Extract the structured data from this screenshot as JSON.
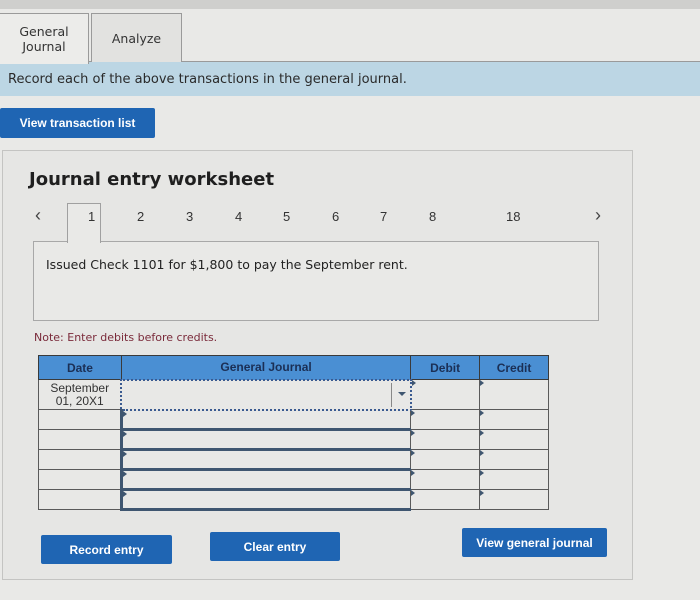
{
  "tabs": [
    {
      "label": "General Journal",
      "active": true
    },
    {
      "label": "Analyze",
      "active": false
    }
  ],
  "instruction": "Record each of the above transactions in the general journal.",
  "view_transaction_list_label": "View transaction list",
  "worksheet": {
    "title": "Journal entry worksheet",
    "pager": {
      "prev_icon": "chevron-left-icon",
      "next_icon": "chevron-right-icon",
      "pages": [
        "1",
        "2",
        "3",
        "4",
        "5",
        "6",
        "7",
        "8",
        "18"
      ],
      "active_page": "1"
    },
    "description": "Issued Check 1101 for $1,800 to pay the September rent.",
    "note": "Note: Enter debits before credits.",
    "table": {
      "headers": {
        "date": "Date",
        "general_journal": "General Journal",
        "debit": "Debit",
        "credit": "Credit"
      },
      "rows": [
        {
          "date_line1": "September",
          "date_line2": "01, 20X1",
          "account": "",
          "debit": "",
          "credit": ""
        },
        {
          "date_line1": "",
          "date_line2": "",
          "account": "",
          "debit": "",
          "credit": ""
        },
        {
          "date_line1": "",
          "date_line2": "",
          "account": "",
          "debit": "",
          "credit": ""
        },
        {
          "date_line1": "",
          "date_line2": "",
          "account": "",
          "debit": "",
          "credit": ""
        },
        {
          "date_line1": "",
          "date_line2": "",
          "account": "",
          "debit": "",
          "credit": ""
        },
        {
          "date_line1": "",
          "date_line2": "",
          "account": "",
          "debit": "",
          "credit": ""
        }
      ]
    },
    "buttons": {
      "record_entry": "Record entry",
      "clear_entry": "Clear entry",
      "view_general_journal": "View general journal"
    }
  },
  "colors": {
    "button_blue": "#1f65b3",
    "header_blue": "#4a8fd3",
    "instruction_bg": "#bcd6e4",
    "note_text": "#7a2a3a"
  }
}
